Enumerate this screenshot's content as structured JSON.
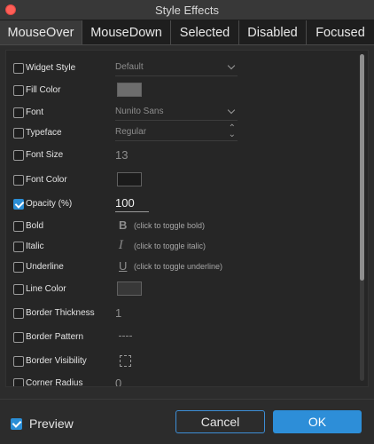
{
  "window": {
    "title": "Style Effects"
  },
  "tabs": [
    {
      "label": "MouseOver",
      "active": true
    },
    {
      "label": "MouseDown",
      "active": false
    },
    {
      "label": "Selected",
      "active": false
    },
    {
      "label": "Disabled",
      "active": false
    },
    {
      "label": "Focused",
      "active": false
    }
  ],
  "properties": {
    "widget_style": {
      "label": "Widget Style",
      "value": "Default",
      "checked": false
    },
    "fill_color": {
      "label": "Fill Color",
      "color": "#6d6d6d",
      "checked": false
    },
    "font": {
      "label": "Font",
      "value": "Nunito Sans",
      "checked": false
    },
    "typeface": {
      "label": "Typeface",
      "value": "Regular",
      "checked": false
    },
    "font_size": {
      "label": "Font Size",
      "value": "13",
      "checked": false
    },
    "font_color": {
      "label": "Font Color",
      "color": "#1b1b1b",
      "checked": false
    },
    "opacity": {
      "label": "Opacity (%)",
      "value": "100",
      "checked": true
    },
    "bold": {
      "label": "Bold",
      "glyph": "B",
      "hint": "(click to toggle bold)",
      "checked": false
    },
    "italic": {
      "label": "Italic",
      "glyph": "I",
      "hint": "(click to toggle italic)",
      "checked": false
    },
    "underline": {
      "label": "Underline",
      "glyph": "U",
      "hint": "(click to toggle underline)",
      "checked": false
    },
    "line_color": {
      "label": "Line Color",
      "color": "#383838",
      "checked": false
    },
    "border_thickness": {
      "label": "Border Thickness",
      "value": "1",
      "checked": false
    },
    "border_pattern": {
      "label": "Border Pattern",
      "icon": "dashed-line-icon",
      "checked": false
    },
    "border_visibility": {
      "label": "Border Visibility",
      "icon": "dashed-box-icon",
      "checked": false
    },
    "corner_radius": {
      "label": "Corner Radius",
      "value": "0",
      "checked": false
    }
  },
  "footer": {
    "preview_label": "Preview",
    "preview_checked": true,
    "cancel_label": "Cancel",
    "ok_label": "OK"
  },
  "colors": {
    "accent": "#2d8ed8",
    "close": "#fe5f57"
  }
}
